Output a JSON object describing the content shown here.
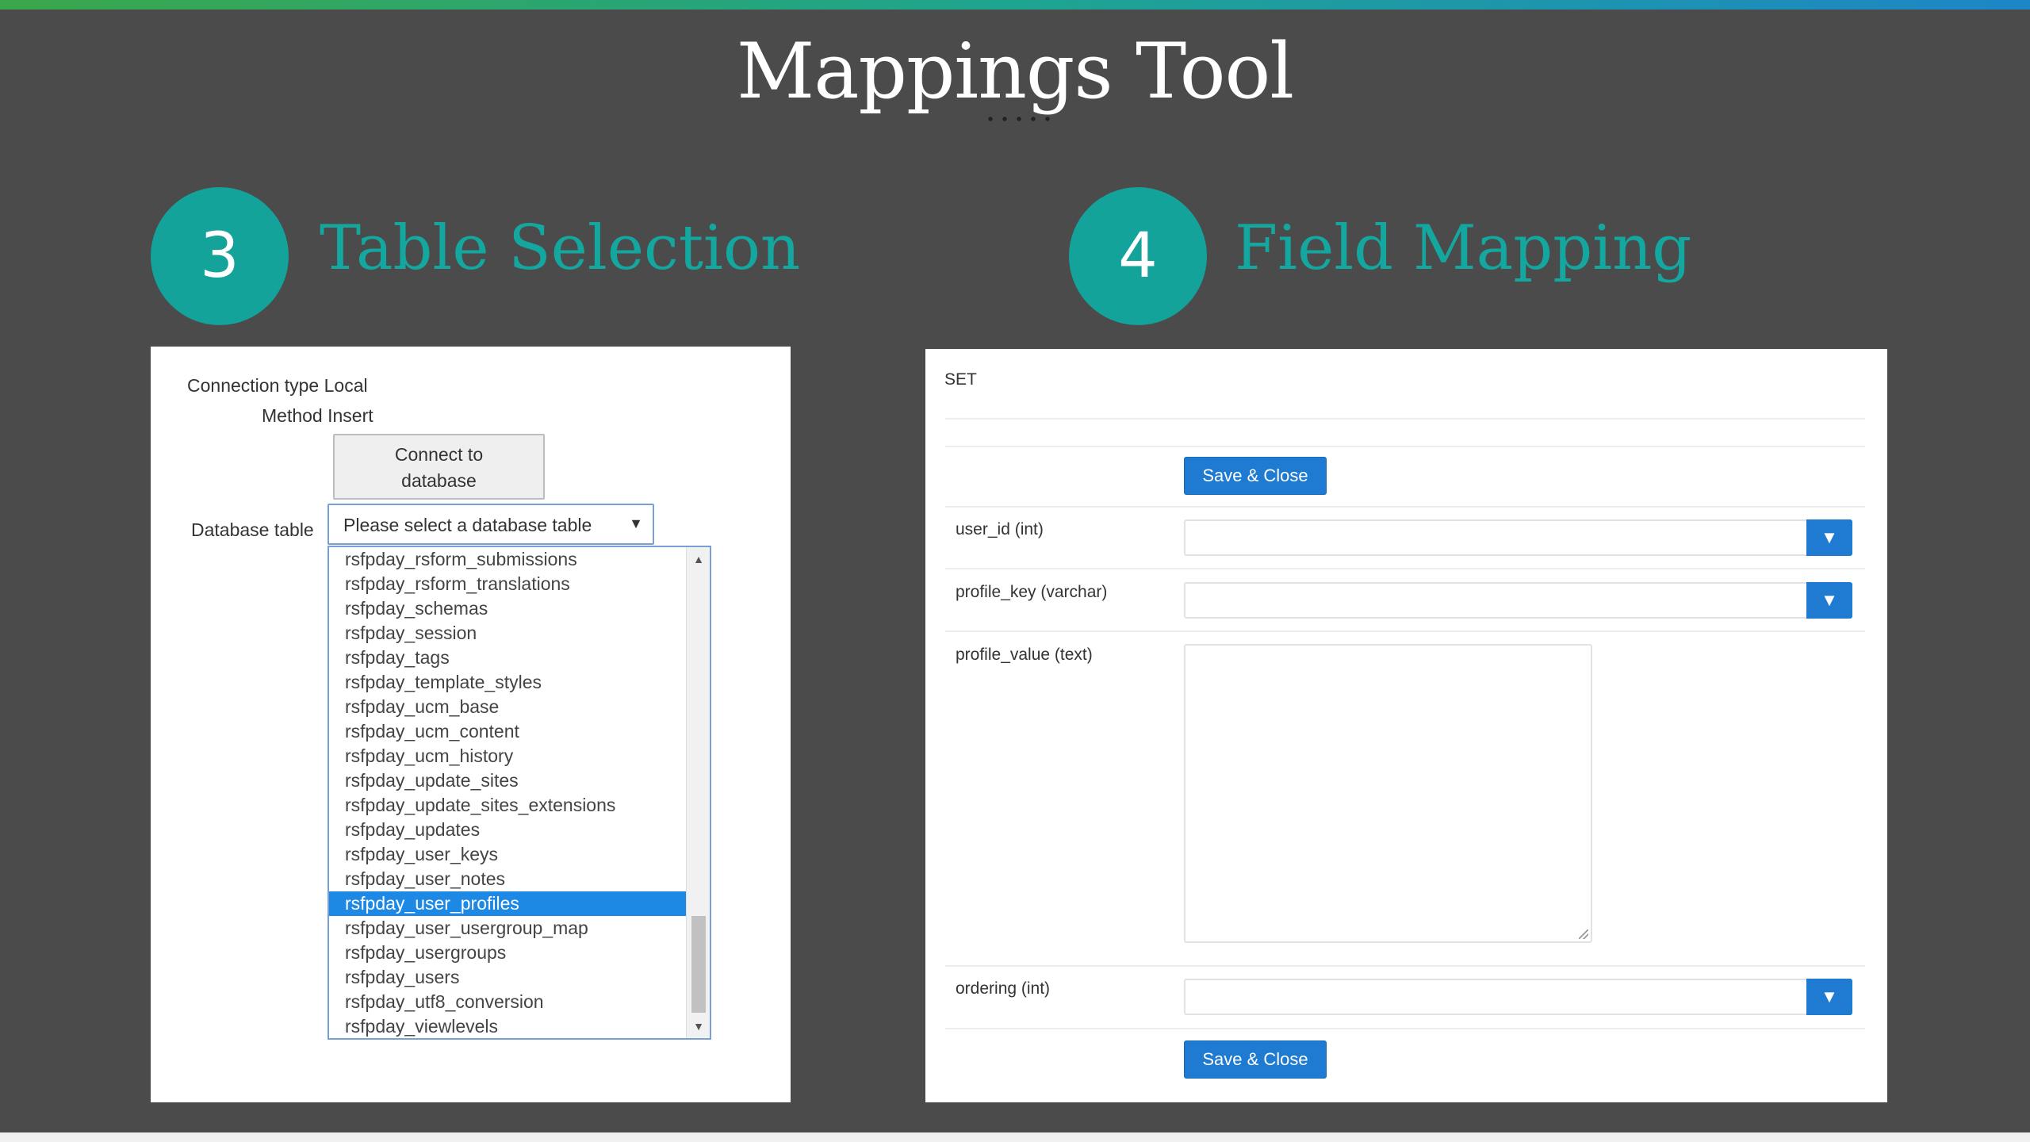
{
  "slide": {
    "title": "Mappings Tool"
  },
  "steps": [
    {
      "number": "3",
      "title": "Table Selection"
    },
    {
      "number": "4",
      "title": "Field Mapping"
    }
  ],
  "table_selection": {
    "connection_type": "Connection type Local",
    "method": "Method Insert",
    "connect_button_line1": "Connect to",
    "connect_button_line2": "database",
    "database_table_label": "Database table",
    "select_placeholder": "Please select a database table",
    "list_items": [
      "rsfpday_rsform_submissions",
      "rsfpday_rsform_translations",
      "rsfpday_schemas",
      "rsfpday_session",
      "rsfpday_tags",
      "rsfpday_template_styles",
      "rsfpday_ucm_base",
      "rsfpday_ucm_content",
      "rsfpday_ucm_history",
      "rsfpday_update_sites",
      "rsfpday_update_sites_extensions",
      "rsfpday_updates",
      "rsfpday_user_keys",
      "rsfpday_user_notes",
      "rsfpday_user_profiles",
      "rsfpday_user_usergroup_map",
      "rsfpday_usergroups",
      "rsfpday_users",
      "rsfpday_utf8_conversion",
      "rsfpday_viewlevels"
    ],
    "selected_item": "rsfpday_user_profiles"
  },
  "field_mapping": {
    "section_label": "SET",
    "save_close_label": "Save & Close",
    "fields": [
      {
        "label": "user_id (int)"
      },
      {
        "label": "profile_key (varchar)"
      },
      {
        "label": "profile_value (text)"
      },
      {
        "label": "ordering (int)"
      }
    ]
  },
  "colors": {
    "accent": "#13a39a",
    "primary_button": "#1f7bd1",
    "background": "#4b4b4b"
  }
}
